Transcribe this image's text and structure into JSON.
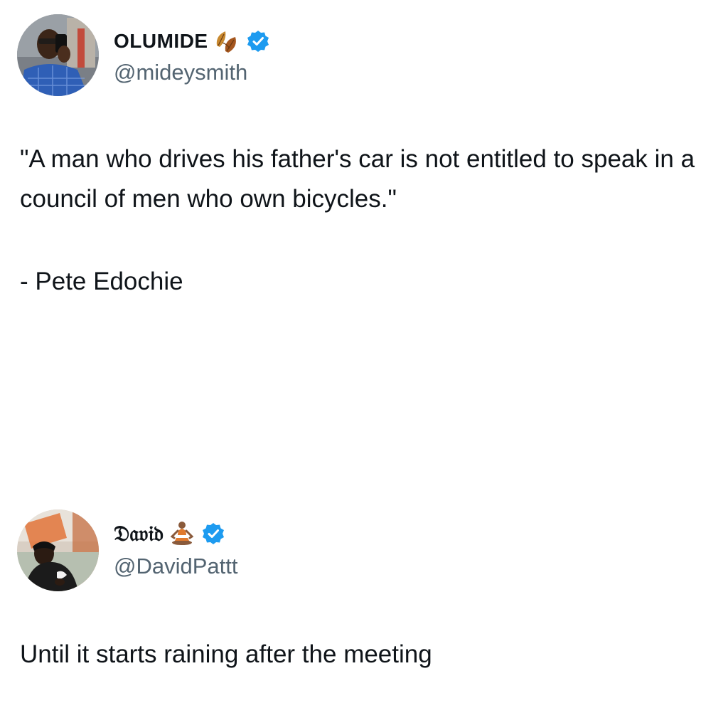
{
  "tweets": [
    {
      "display_name": "OLUMIDE",
      "name_emoji": "fallen-leaf-icon",
      "verified": true,
      "handle": "@mideysmith",
      "lines": [
        "\"A man who drives his father's car is not entitled to speak in a council of men who own bicycles.\"",
        "- Pete Edochie"
      ]
    },
    {
      "display_name": "𝔇𝔞𝔳𝔦𝔡",
      "name_emoji": "person-in-lotus-position-icon",
      "verified": true,
      "handle": "@DavidPattt",
      "lines": [
        "Until it starts raining after the meeting"
      ]
    }
  ],
  "colors": {
    "verified_badge": "#1d9bf0",
    "handle_text": "#536471",
    "body_text": "#0f1419"
  }
}
